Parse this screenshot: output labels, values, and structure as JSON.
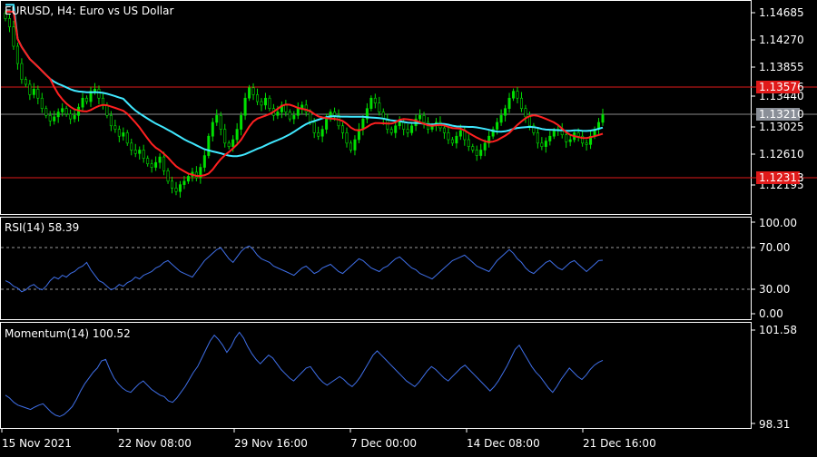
{
  "main_pane": {
    "title": "EURUSD, H4:  Euro vs US Dollar",
    "price_ticks": [
      "1.14685",
      "1.14270",
      "1.13855",
      "1.13440",
      "1.13025",
      "1.12610",
      "1.12195"
    ],
    "levels": {
      "resistance_label": "1.13576",
      "current_label": "1.13210",
      "support_label": "1.12313"
    },
    "colors": {
      "up_candle": "#00e000",
      "down_candle": "#00e000",
      "ma_fast": "#ff2020",
      "ma_slow": "#40e8ff",
      "level_line": "#e01a1a",
      "level_tag": "#e01a1a",
      "current_tag": "#8a8f98"
    }
  },
  "rsi_pane": {
    "title": "RSI(14) 58.39",
    "ticks": [
      "100.00",
      "70.00",
      "30.00",
      "0.00"
    ],
    "color": "#3f6fe8"
  },
  "momentum_pane": {
    "title": "Momentum(14) 100.52",
    "ticks": [
      "101.58",
      "98.31"
    ],
    "color": "#3f6fe8"
  },
  "time_axis": {
    "labels": [
      "15 Nov 2021",
      "22 Nov 08:00",
      "29 Nov 16:00",
      "7 Dec 00:00",
      "14 Dec 08:00",
      "21 Dec 16:00"
    ]
  },
  "chart_data": [
    {
      "type": "candlestick",
      "title": "EURUSD, H4:  Euro vs US Dollar",
      "ylim": [
        1.1195,
        1.1483
      ],
      "x_tick_labels": [
        "15 Nov 2021",
        "22 Nov 08:00",
        "29 Nov 16:00",
        "7 Dec 00:00",
        "14 Dec 08:00",
        "21 Dec 16:00"
      ],
      "y_tick_labels": [
        "1.14685",
        "1.14270",
        "1.13855",
        "1.13440",
        "1.13025",
        "1.12610",
        "1.12195"
      ],
      "close": [
        1.146,
        1.1448,
        1.142,
        1.1395,
        1.1372,
        1.1365,
        1.135,
        1.1358,
        1.1345,
        1.133,
        1.132,
        1.1312,
        1.1318,
        1.1325,
        1.133,
        1.1322,
        1.1315,
        1.132,
        1.1332,
        1.1345,
        1.134,
        1.1355,
        1.1358,
        1.1345,
        1.1335,
        1.132,
        1.1305,
        1.13,
        1.129,
        1.1295,
        1.128,
        1.127,
        1.1265,
        1.127,
        1.1258,
        1.125,
        1.1245,
        1.1252,
        1.126,
        1.124,
        1.1225,
        1.1215,
        1.121,
        1.122,
        1.1225,
        1.1232,
        1.1238,
        1.123,
        1.1245,
        1.1262,
        1.129,
        1.131,
        1.132,
        1.13,
        1.128,
        1.1275,
        1.1285,
        1.13,
        1.132,
        1.1345,
        1.136,
        1.135,
        1.134,
        1.1335,
        1.1345,
        1.133,
        1.132,
        1.1325,
        1.1335,
        1.1325,
        1.1315,
        1.132,
        1.133,
        1.1335,
        1.1325,
        1.131,
        1.1295,
        1.129,
        1.13,
        1.1315,
        1.1325,
        1.132,
        1.1305,
        1.1295,
        1.128,
        1.127,
        1.1285,
        1.13,
        1.1315,
        1.133,
        1.1345,
        1.1338,
        1.1325,
        1.1315,
        1.13,
        1.1295,
        1.1305,
        1.131,
        1.13,
        1.1295,
        1.1305,
        1.1315,
        1.132,
        1.131,
        1.13,
        1.1305,
        1.131,
        1.1302,
        1.1295,
        1.1285,
        1.128,
        1.129,
        1.1298,
        1.1285,
        1.1275,
        1.127,
        1.1262,
        1.127,
        1.128,
        1.129,
        1.13,
        1.131,
        1.132,
        1.133,
        1.1345,
        1.1355,
        1.1345,
        1.133,
        1.1318,
        1.1305,
        1.1295,
        1.128,
        1.1275,
        1.1283,
        1.129,
        1.1298,
        1.13,
        1.1292,
        1.1282,
        1.1285,
        1.1295,
        1.129,
        1.128,
        1.1278,
        1.129,
        1.13,
        1.131,
        1.1321
      ],
      "ma_fast": {
        "color": "#ff2020"
      },
      "ma_slow": {
        "color": "#40e8ff"
      },
      "levels": [
        1.13576,
        1.1321,
        1.12313
      ]
    },
    {
      "type": "line",
      "title": "RSI(14) 58.39",
      "ylim": [
        0,
        100
      ],
      "values": [
        36,
        34,
        30,
        28,
        24,
        26,
        30,
        32,
        28,
        26,
        30,
        36,
        40,
        38,
        42,
        40,
        44,
        46,
        50,
        52,
        56,
        48,
        42,
        36,
        34,
        30,
        26,
        28,
        32,
        30,
        34,
        36,
        40,
        38,
        42,
        44,
        46,
        50,
        52,
        56,
        58,
        54,
        50,
        46,
        44,
        42,
        40,
        46,
        52,
        58,
        62,
        66,
        70,
        72,
        66,
        60,
        56,
        62,
        68,
        72,
        74,
        70,
        64,
        60,
        58,
        56,
        52,
        50,
        48,
        46,
        44,
        42,
        46,
        50,
        52,
        48,
        44,
        46,
        50,
        52,
        54,
        50,
        46,
        44,
        48,
        52,
        56,
        60,
        58,
        54,
        50,
        48,
        46,
        50,
        52,
        56,
        60,
        62,
        58,
        54,
        50,
        48,
        44,
        42,
        40,
        38,
        42,
        46,
        50,
        54,
        58,
        60,
        62,
        64,
        60,
        56,
        52,
        50,
        48,
        46,
        52,
        58,
        62,
        66,
        70,
        66,
        60,
        56,
        50,
        46,
        44,
        48,
        52,
        56,
        58,
        54,
        50,
        48,
        52,
        56,
        58,
        54,
        50,
        46,
        50,
        54,
        58,
        58.39
      ],
      "reference_levels": [
        70,
        30
      ]
    },
    {
      "type": "line",
      "title": "Momentum(14) 100.52",
      "ylim": [
        98.31,
        101.58
      ],
      "values": [
        99.3,
        99.2,
        99.05,
        98.95,
        98.9,
        98.85,
        98.8,
        98.88,
        98.95,
        99.0,
        98.85,
        98.7,
        98.6,
        98.55,
        98.62,
        98.75,
        98.9,
        99.15,
        99.45,
        99.7,
        99.9,
        100.1,
        100.25,
        100.5,
        100.55,
        100.2,
        99.9,
        99.7,
        99.55,
        99.45,
        99.4,
        99.55,
        99.7,
        99.8,
        99.65,
        99.5,
        99.4,
        99.3,
        99.25,
        99.1,
        99.05,
        99.2,
        99.4,
        99.6,
        99.85,
        100.1,
        100.3,
        100.6,
        100.9,
        101.2,
        101.4,
        101.25,
        101.05,
        100.8,
        101.0,
        101.3,
        101.5,
        101.3,
        101.0,
        100.75,
        100.55,
        100.4,
        100.55,
        100.7,
        100.6,
        100.4,
        100.2,
        100.05,
        99.9,
        99.8,
        99.95,
        100.1,
        100.25,
        100.3,
        100.1,
        99.9,
        99.75,
        99.65,
        99.75,
        99.85,
        99.95,
        99.85,
        99.7,
        99.6,
        99.75,
        99.95,
        100.2,
        100.45,
        100.7,
        100.85,
        100.7,
        100.55,
        100.4,
        100.25,
        100.1,
        99.95,
        99.8,
        99.7,
        99.6,
        99.75,
        99.95,
        100.15,
        100.3,
        100.2,
        100.05,
        99.9,
        99.8,
        99.95,
        100.1,
        100.25,
        100.35,
        100.2,
        100.05,
        99.9,
        99.75,
        99.6,
        99.45,
        99.6,
        99.8,
        100.05,
        100.3,
        100.6,
        100.9,
        101.05,
        100.8,
        100.55,
        100.3,
        100.1,
        99.95,
        99.75,
        99.55,
        99.4,
        99.6,
        99.85,
        100.05,
        100.25,
        100.1,
        99.95,
        99.85,
        100.0,
        100.2,
        100.35,
        100.45,
        100.52
      ]
    }
  ]
}
